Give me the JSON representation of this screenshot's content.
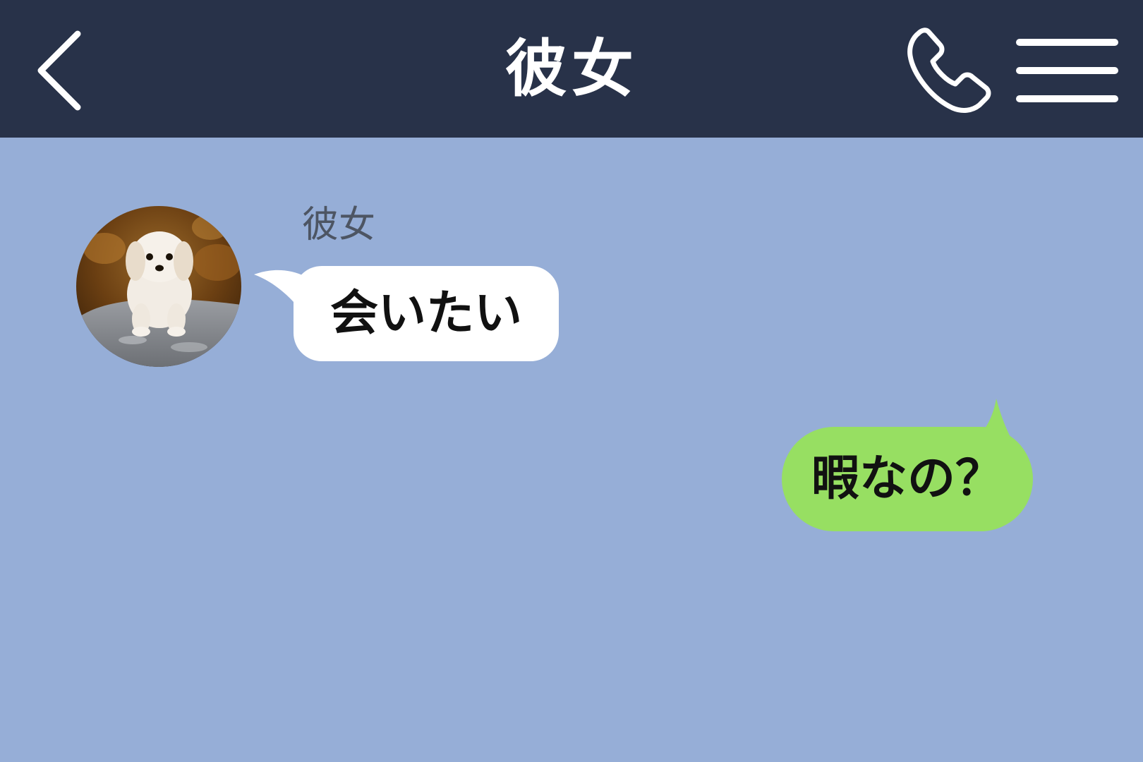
{
  "header": {
    "title": "彼女",
    "back_icon": "chevron-left-icon",
    "call_icon": "phone-icon",
    "menu_icon": "hamburger-menu-icon",
    "background_color": "#283249"
  },
  "chat": {
    "background_color": "#96AED7",
    "messages": [
      {
        "direction": "incoming",
        "sender": "彼女",
        "avatar": "puppy-avatar",
        "text": "会いたい",
        "bubble_color": "#FFFFFF"
      },
      {
        "direction": "outgoing",
        "text": "暇なの？",
        "bubble_color": "#97DF62"
      }
    ]
  }
}
